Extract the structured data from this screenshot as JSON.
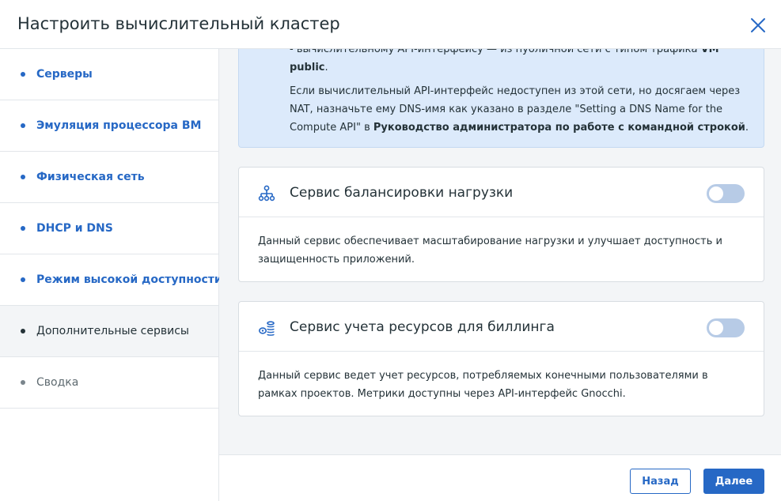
{
  "dialog": {
    "title": "Настроить вычислительный кластер"
  },
  "sidebar": {
    "items": [
      {
        "label": "Серверы",
        "state": "done"
      },
      {
        "label": "Эмуляция процессора ВМ",
        "state": "done"
      },
      {
        "label": "Физическая сеть",
        "state": "done"
      },
      {
        "label": "DHCP и DNS",
        "state": "done"
      },
      {
        "label": "Режим высокой доступности",
        "state": "done"
      },
      {
        "label": "Дополнительные сервисы",
        "state": "active"
      },
      {
        "label": "Сводка",
        "state": "pending"
      }
    ]
  },
  "info": {
    "line1_text": "- вычислительному API-интерфейсу — из публичной сети с типом трафика ",
    "line1_bold": "VM public",
    "line1_end": ".",
    "p2_text": "Если вычислительный API-интерфейс недоступен из этой сети, но досягаем через NAT, назначьте ему DNS-имя как указано в разделе \"Setting a DNS Name for the Compute API\" в ",
    "p2_bold": "Руководство администратора по работе с командной строкой",
    "p2_end": "."
  },
  "cards": [
    {
      "icon": "load-balancer-icon",
      "title": "Сервис балансировки нагрузки",
      "enabled": false,
      "description": "Данный сервис обеспечивает масштабирование нагрузки и улучшает доступность и защищенность приложений."
    },
    {
      "icon": "billing-coins-icon",
      "title": "Сервис учета ресурсов для биллинга",
      "enabled": false,
      "description": "Данный сервис ведет учет ресурсов, потребляемых конечными пользователями в рамках проектов. Метрики доступны через API-интерфейс Gnocchi."
    }
  ],
  "footer": {
    "back_label": "Назад",
    "next_label": "Далее"
  },
  "colors": {
    "accent": "#2668c5",
    "info_bg": "#dceafb",
    "toggle_off": "#b7cbe6",
    "content_bg": "#f3f5f7"
  }
}
